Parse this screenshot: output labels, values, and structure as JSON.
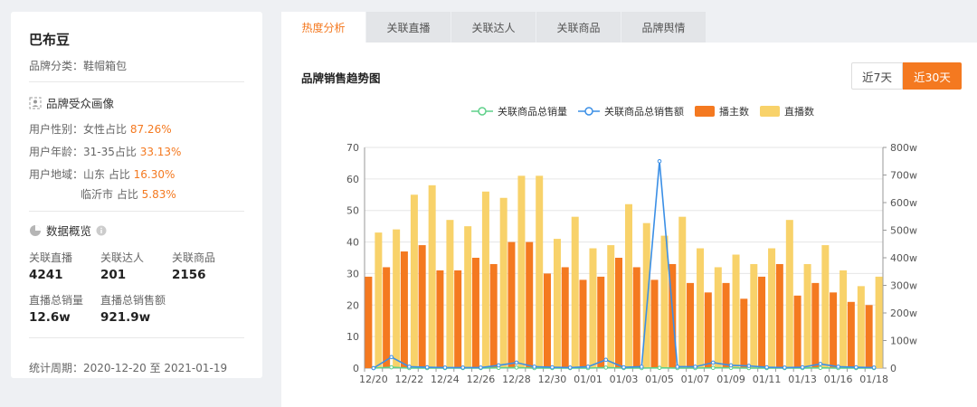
{
  "brand": {
    "name": "巴布豆",
    "category_label": "品牌分类：鞋帽箱包"
  },
  "audience": {
    "title": "品牌受众画像",
    "gender_label": "用户性别：女性占比",
    "gender_value": "87.26%",
    "age_label": "用户年龄：31-35占比",
    "age_value": "33.13%",
    "region_label": "用户地域：山东 占比",
    "region_value": "16.30%",
    "region2_label": "临沂市 占比",
    "region2_value": "5.83%"
  },
  "overview": {
    "title": "数据概览",
    "stats": [
      {
        "label": "关联直播",
        "value": "4241"
      },
      {
        "label": "关联达人",
        "value": "201"
      },
      {
        "label": "关联商品",
        "value": "2156"
      },
      {
        "label": "直播总销量",
        "value": "12.6w"
      },
      {
        "label": "直播总销售额",
        "value": "921.9w"
      }
    ],
    "period": "统计周期：2020-12-20 至 2021-01-19"
  },
  "tabs": [
    {
      "label": "热度分析",
      "active": true
    },
    {
      "label": "关联直播",
      "active": false
    },
    {
      "label": "关联达人",
      "active": false
    },
    {
      "label": "关联商品",
      "active": false
    },
    {
      "label": "品牌舆情",
      "active": false
    }
  ],
  "range": {
    "btn7": "近7天",
    "btn30": "近30天"
  },
  "colors": {
    "accent": "#f47920",
    "bar_anchor": "#f47920",
    "bar_live": "#f8d26a",
    "line_sales_qty": "#5fd08a",
    "line_sales_amt": "#3b8fe6"
  },
  "chart_data": {
    "type": "bar",
    "title": "品牌销售趋势图",
    "categories": [
      "12/20",
      "12/21",
      "12/22",
      "12/23",
      "12/24",
      "12/25",
      "12/26",
      "12/27",
      "12/28",
      "12/29",
      "12/30",
      "12/31",
      "01/01",
      "01/02",
      "01/03",
      "01/04",
      "01/05",
      "01/06",
      "01/07",
      "01/08",
      "01/09",
      "01/10",
      "01/11",
      "01/12",
      "01/13",
      "01/14",
      "01/16",
      "01/17",
      "01/18"
    ],
    "xtick_labels": [
      "12/20",
      "12/22",
      "12/24",
      "12/26",
      "12/28",
      "12/30",
      "01/01",
      "01/03",
      "01/05",
      "01/07",
      "01/09",
      "01/11",
      "01/13",
      "01/16",
      "01/18"
    ],
    "series": [
      {
        "name": "关联商品总销量",
        "type": "line",
        "axis": "right",
        "values": [
          0,
          3,
          0,
          0,
          0,
          0,
          0,
          1,
          2,
          0,
          0,
          0,
          0,
          2,
          0,
          0,
          1,
          0,
          0,
          1,
          1,
          0,
          0,
          0,
          0,
          1,
          0,
          0,
          0
        ]
      },
      {
        "name": "关联商品总销售额",
        "type": "line",
        "axis": "right",
        "values": [
          0,
          40,
          5,
          3,
          2,
          2,
          2,
          10,
          20,
          5,
          3,
          2,
          5,
          30,
          3,
          5,
          750,
          5,
          5,
          20,
          10,
          8,
          3,
          2,
          3,
          15,
          5,
          3,
          2
        ]
      },
      {
        "name": "播主数",
        "type": "bar",
        "axis": "left",
        "values": [
          29,
          32,
          37,
          39,
          31,
          31,
          35,
          33,
          40,
          40,
          30,
          32,
          28,
          29,
          35,
          32,
          28,
          33,
          27,
          24,
          27,
          22,
          29,
          33,
          23,
          27,
          24,
          21,
          20
        ]
      },
      {
        "name": "直播数",
        "type": "bar",
        "axis": "left",
        "values": [
          43,
          44,
          55,
          58,
          47,
          45,
          56,
          54,
          61,
          61,
          41,
          48,
          38,
          39,
          52,
          46,
          42,
          48,
          38,
          32,
          36,
          33,
          38,
          47,
          33,
          39,
          31,
          26,
          29
        ]
      }
    ],
    "y_left": {
      "ylim": [
        0,
        70
      ],
      "ticks": [
        "0",
        "10",
        "20",
        "30",
        "40",
        "50",
        "60",
        "70"
      ]
    },
    "y_right": {
      "ylim": [
        0,
        800
      ],
      "ticks": [
        "0",
        "100w",
        "200w",
        "300w",
        "400w",
        "500w",
        "600w",
        "700w",
        "800w"
      ]
    },
    "grid": true,
    "legend_position": "top-center"
  }
}
